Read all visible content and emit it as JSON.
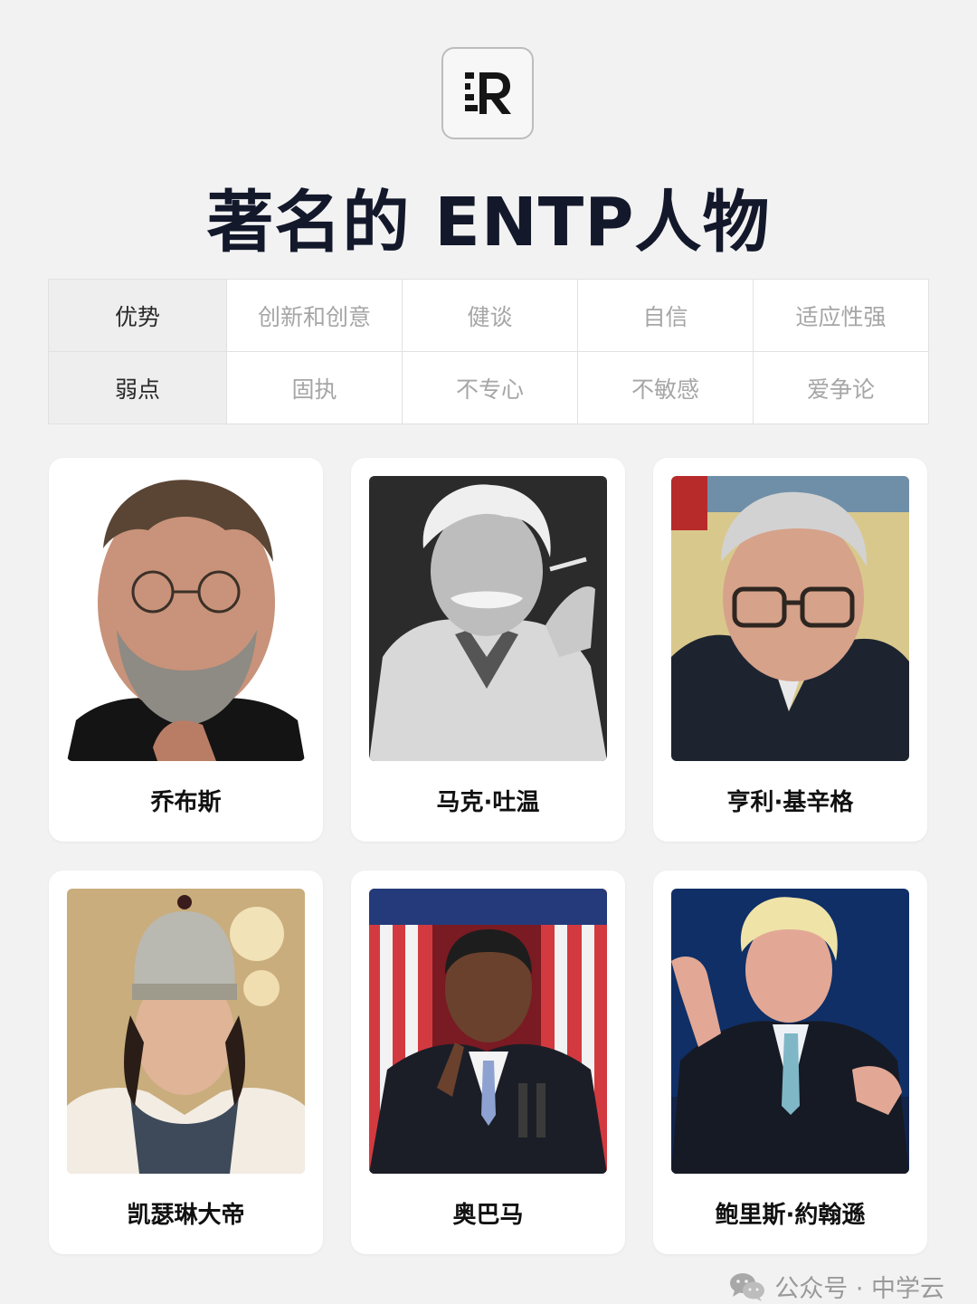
{
  "header": {
    "logo_icon": "brand-r-logo",
    "title": "著名的 ENTP人物"
  },
  "traits": {
    "rows": [
      {
        "label": "优势",
        "values": [
          "创新和创意",
          "健谈",
          "自信",
          "适应性强"
        ]
      },
      {
        "label": "弱点",
        "values": [
          "固执",
          "不专心",
          "不敏感",
          "爱争论"
        ]
      }
    ]
  },
  "people": [
    {
      "name": "乔布斯",
      "photo": "portrait-photo"
    },
    {
      "name": "马克·吐温",
      "photo": "portrait-photo"
    },
    {
      "name": "亨利·基辛格",
      "photo": "portrait-photo"
    },
    {
      "name": "凯瑟琳大帝",
      "photo": "portrait-photo"
    },
    {
      "name": "奥巴马",
      "photo": "portrait-photo"
    },
    {
      "name": "鲍里斯·約翰遜",
      "photo": "portrait-photo"
    }
  ],
  "footer": {
    "icon": "wechat-icon",
    "text": "公众号 · 中学云"
  }
}
